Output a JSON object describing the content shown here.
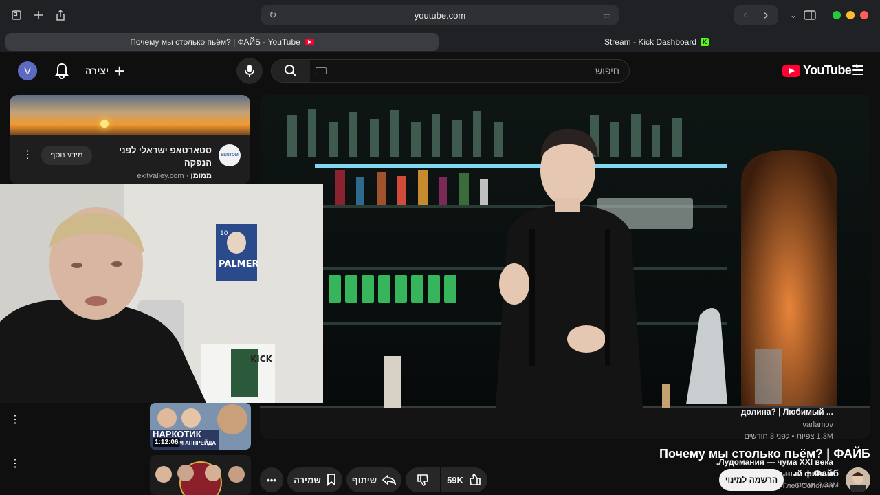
{
  "browser": {
    "url": "youtube.com",
    "tabs": [
      {
        "title": "Почему мы столько пьём? | ФАЙБ - YouTube"
      },
      {
        "title": "Stream - Kick Dashboard"
      }
    ],
    "traffic_lights": [
      "#27c93f",
      "#ffbd2e",
      "#ff5f57"
    ]
  },
  "header": {
    "avatar_letter": "V",
    "create_label": "יצירה",
    "search_placeholder": "חיפוש",
    "logo_text": "YouTube",
    "logo_country": "IL"
  },
  "video": {
    "title": "Почему мы столько пьём? | ФАЙБ",
    "channel": "Файб",
    "subscribers": "2.33M מנויים",
    "subscribe_label": "הרשמה למינוי",
    "likes": "59K",
    "share_label": "שיתוף",
    "save_label": "שמירה"
  },
  "ad": {
    "title": "סטארטאפ ישראלי לפני הנפקה",
    "sponsored": "ממומן",
    "domain": "exitvalley.com",
    "more_label": "מידע נוסף",
    "logo_text": "SENTOM"
  },
  "recommendations": [
    {
      "title_line1": "... долина? | Любимый",
      "channel": "varlamov",
      "views": "1.3M צפיות",
      "age": "לפני 3 חודשים",
      "duration": "1:12:06",
      "thumb_text1": "НАРКОТИК",
      "thumb_text2": "ОМ АППРЕЙДА"
    },
    {
      "title_line1": "Лудомания — чума XXI века.",
      "title_line2": "Документальный фильм.",
      "channel": "Глеб Соломин"
    }
  ],
  "webcam": {
    "poster_number": "10",
    "poster_name": "PALMER",
    "sign_text": "KICK"
  }
}
